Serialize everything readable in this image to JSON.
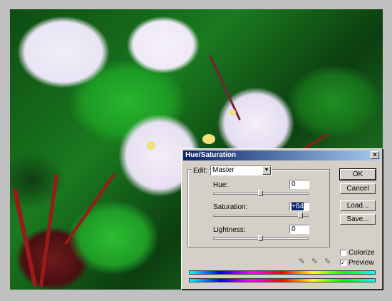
{
  "dialog": {
    "title": "Hue/Saturation",
    "close_icon": "close-icon",
    "edit_label": "Edit:",
    "edit_value": "Master",
    "hue": {
      "label": "Hue:",
      "value": "0",
      "slider_fraction": 0.5
    },
    "saturation": {
      "label": "Saturation:",
      "value": "+84",
      "slider_fraction": 0.92
    },
    "lightness": {
      "label": "Lightness:",
      "value": "0",
      "slider_fraction": 0.5
    },
    "buttons": {
      "ok": "OK",
      "cancel": "Cancel",
      "load": "Load...",
      "save": "Save..."
    },
    "colorize": {
      "label": "Colorize",
      "checked": false
    },
    "preview": {
      "label": "Preview",
      "checked": true
    },
    "eyedroppers": [
      "eyedropper-icon",
      "eyedropper-plus-icon",
      "eyedropper-minus-icon"
    ]
  },
  "colors": {
    "title_start": "#0a246a",
    "title_end": "#a6caf0",
    "dialog_bg": "#d4d0c8"
  }
}
